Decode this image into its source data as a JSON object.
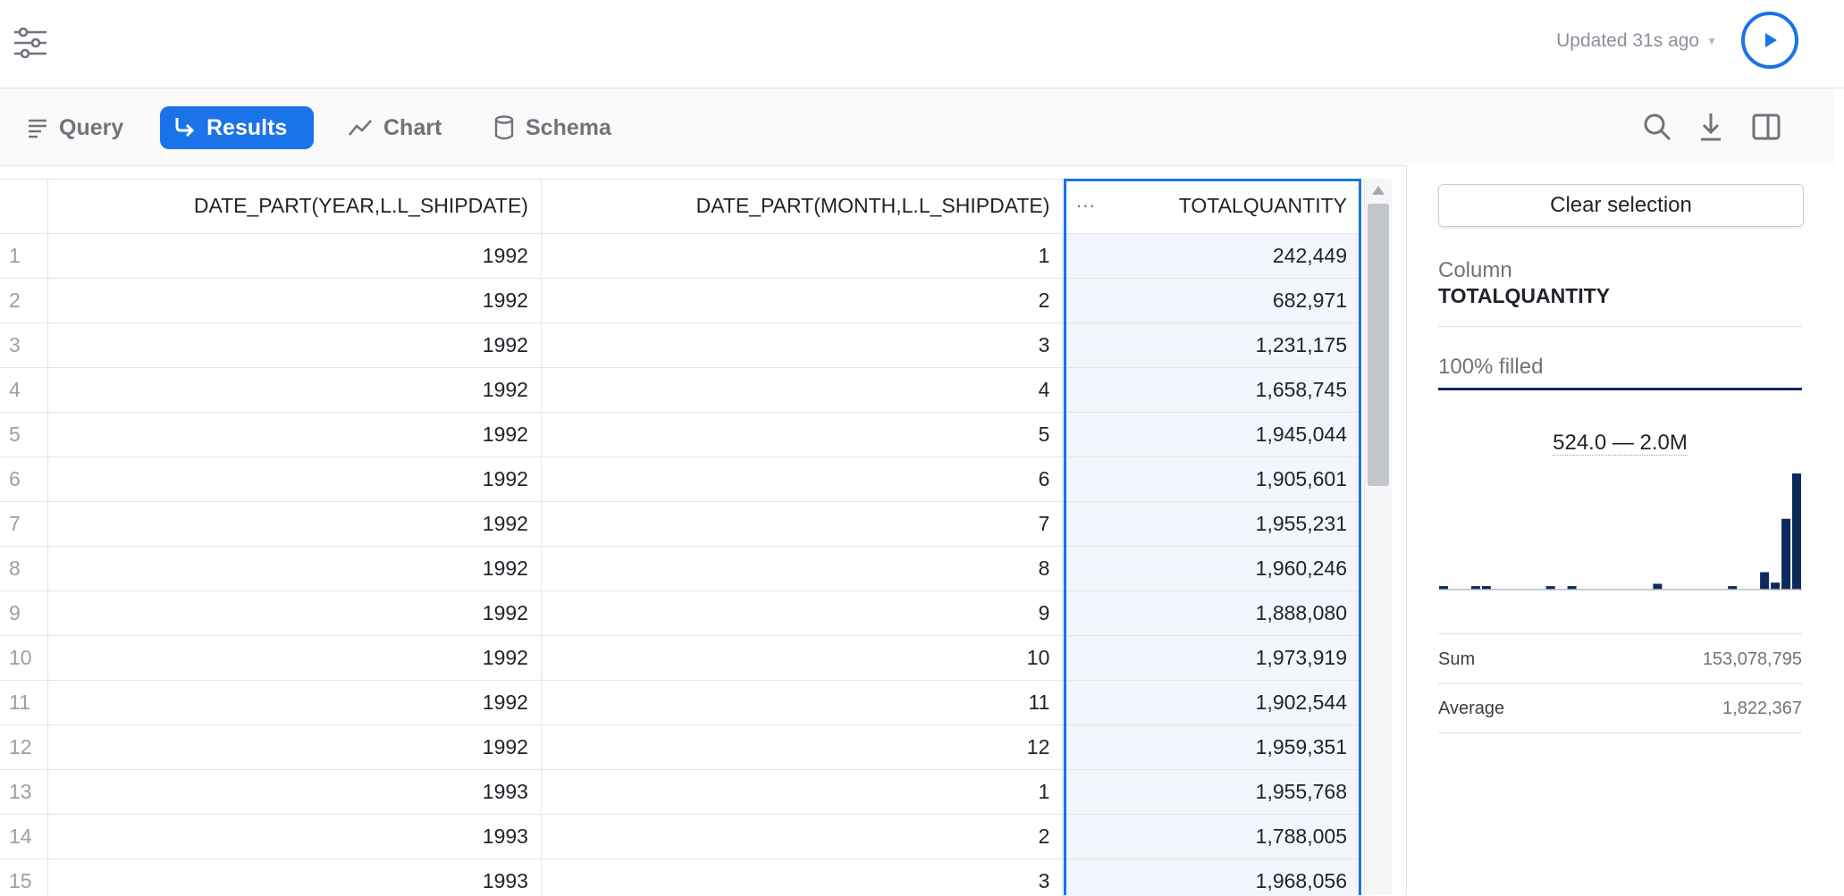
{
  "topbar": {
    "filter_icon": "sliders-icon",
    "updated_text": "Updated 31s ago",
    "run_icon": "play-icon"
  },
  "tabs": [
    {
      "label": "Query",
      "icon": "lines-icon",
      "active": false
    },
    {
      "label": "Results",
      "icon": "return-arrow-icon",
      "active": true
    },
    {
      "label": "Chart",
      "icon": "trend-line-icon",
      "active": false
    },
    {
      "label": "Schema",
      "icon": "database-icon",
      "active": false
    }
  ],
  "toolbar_icons": [
    "search-icon",
    "download-icon",
    "panel-toggle-icon"
  ],
  "table": {
    "columns": [
      "DATE_PART(YEAR,L.L_SHIPDATE)",
      "DATE_PART(MONTH,L.L_SHIPDATE)",
      "TOTALQUANTITY"
    ],
    "column_menu_glyph": "···",
    "rows": [
      [
        "1",
        "1992",
        "1",
        "242,449"
      ],
      [
        "2",
        "1992",
        "2",
        "682,971"
      ],
      [
        "3",
        "1992",
        "3",
        "1,231,175"
      ],
      [
        "4",
        "1992",
        "4",
        "1,658,745"
      ],
      [
        "5",
        "1992",
        "5",
        "1,945,044"
      ],
      [
        "6",
        "1992",
        "6",
        "1,905,601"
      ],
      [
        "7",
        "1992",
        "7",
        "1,955,231"
      ],
      [
        "8",
        "1992",
        "8",
        "1,960,246"
      ],
      [
        "9",
        "1992",
        "9",
        "1,888,080"
      ],
      [
        "10",
        "1992",
        "10",
        "1,973,919"
      ],
      [
        "11",
        "1992",
        "11",
        "1,902,544"
      ],
      [
        "12",
        "1992",
        "12",
        "1,959,351"
      ],
      [
        "13",
        "1993",
        "1",
        "1,955,768"
      ],
      [
        "14",
        "1993",
        "2",
        "1,788,005"
      ],
      [
        "15",
        "1993",
        "3",
        "1,968,056"
      ]
    ]
  },
  "panel": {
    "clear_label": "Clear selection",
    "column_label": "Column",
    "column_name": "TOTALQUANTITY",
    "filled_text": "100% filled",
    "range_text": "524.0 — 2.0M",
    "histogram": [
      0.03,
      0,
      0,
      0.03,
      0.03,
      0,
      0,
      0,
      0,
      0,
      0.03,
      0,
      0.03,
      0,
      0,
      0,
      0,
      0,
      0,
      0,
      0.05,
      0,
      0,
      0,
      0,
      0,
      0,
      0.03,
      0,
      0,
      0.15,
      0.06,
      0.61,
      1.0
    ],
    "stats": [
      {
        "label": "Sum",
        "value": "153,078,795"
      },
      {
        "label": "Average",
        "value": "1,822,367"
      }
    ],
    "accent_color": "#0e2a5c"
  },
  "colors": {
    "accent": "#1a73e8"
  }
}
